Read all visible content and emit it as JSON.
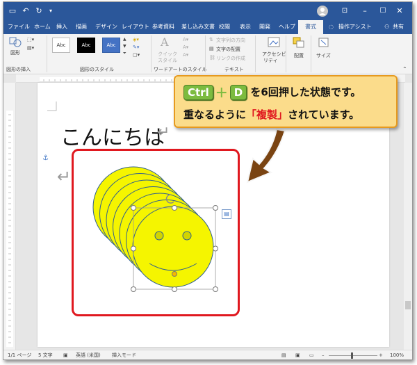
{
  "titlebar": {
    "save_icon": "save-icon",
    "undo_icon": "undo-icon",
    "redo_icon": "redo-icon",
    "customize_icon": "customize-qat-icon",
    "account_icon": "account-avatar",
    "window_buttons": [
      "ribbon-options",
      "minimize",
      "maximize",
      "close"
    ]
  },
  "tabs": [
    {
      "label": "ファイル"
    },
    {
      "label": "ホーム"
    },
    {
      "label": "挿入"
    },
    {
      "label": "描画"
    },
    {
      "label": "デザイン"
    },
    {
      "label": "レイアウト"
    },
    {
      "label": "参考資料"
    },
    {
      "label": "差し込み文書"
    },
    {
      "label": "校閲"
    },
    {
      "label": "表示"
    },
    {
      "label": "開発"
    },
    {
      "label": "ヘルプ"
    },
    {
      "label": "書式",
      "active": true
    }
  ],
  "tell_me": "操作アシスト",
  "share": "共有",
  "ribbon": {
    "insert_shapes": {
      "shape_label": "図形",
      "group_label": "図形の挿入"
    },
    "shape_styles": {
      "sample_text": [
        "Abc",
        "Abc",
        "Abc"
      ],
      "group_label": "図形のスタイル"
    },
    "wordart": {
      "quick_label": "クイック",
      "style_label": "スタイル",
      "group_label": "ワードアートのスタイル"
    },
    "text": {
      "direction": "文字列の方向",
      "align": "文字の配置",
      "link": "リンクの作成",
      "group_label": "テキスト"
    },
    "accessibility": {
      "label_line1": "アクセシビ",
      "label_line2": "リティ"
    },
    "arrange": {
      "label": "配置"
    },
    "size": {
      "label": "サイズ"
    }
  },
  "document": {
    "greeting": "こんにちは",
    "return_mark": "↵"
  },
  "callout": {
    "key1": "Ctrl",
    "plus": "＋",
    "key2": "D",
    "line1_rest": "を6回押した状態です。",
    "line2_pre": "重なるように",
    "line2_highlight": "「複製」",
    "line2_post": "されています。"
  },
  "status": {
    "page": "1/1 ページ",
    "words": "5 文字",
    "language": "英語 (米国)",
    "mode": "挿入モード",
    "zoom": "100%"
  },
  "colors": {
    "titlebar": "#2b579a",
    "face_fill": "#f5f500",
    "face_stroke": "#2f5f8f",
    "highlight_red": "#e0181f",
    "callout_fill": "#fbdc8b",
    "key_green": "#7cbb3f"
  },
  "smiley_count": 7
}
